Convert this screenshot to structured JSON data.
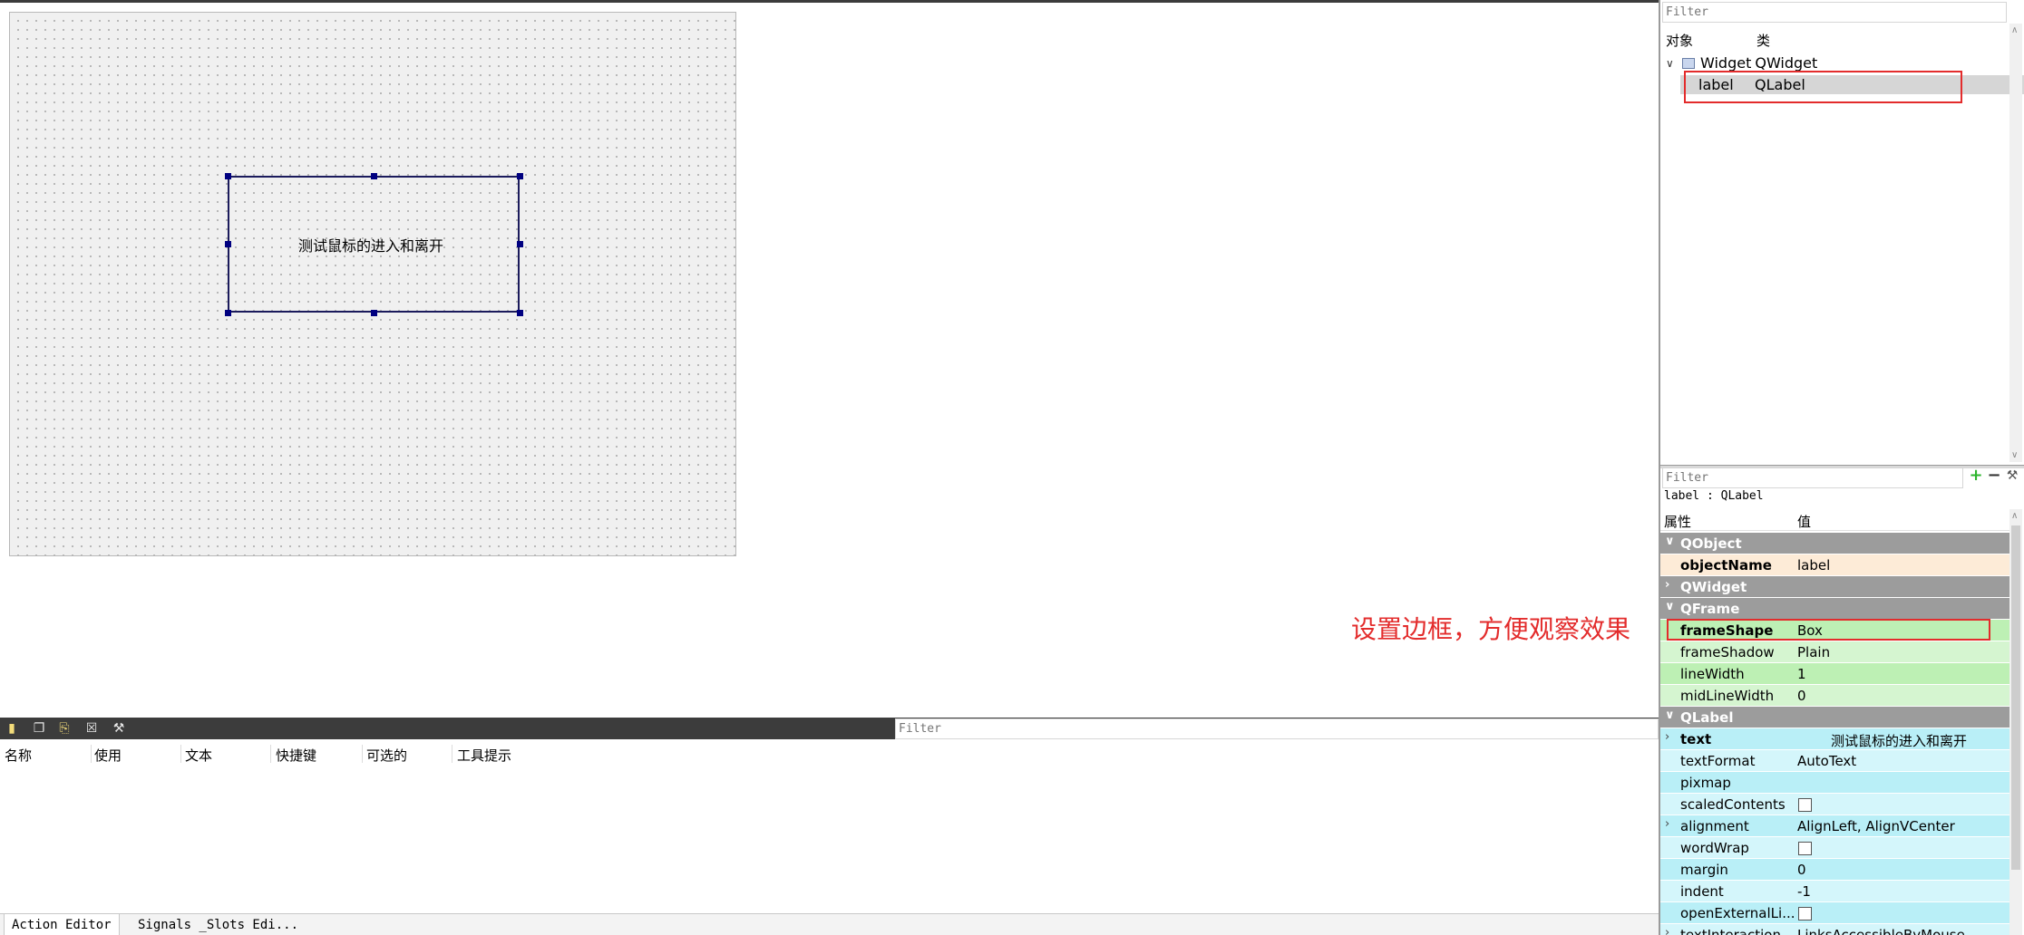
{
  "canvas": {
    "label_text": "测试鼠标的进入和离开"
  },
  "object_inspector": {
    "filter_placeholder": "Filter",
    "col_object": "对象",
    "col_class": "类",
    "tree": [
      {
        "name": "Widget",
        "class": "QWidget"
      },
      {
        "name": "label",
        "class": "QLabel"
      }
    ]
  },
  "property_editor": {
    "filter_placeholder": "Filter",
    "current_object": "label : QLabel",
    "col_property": "属性",
    "col_value": "值",
    "groups": {
      "qobject": "QObject",
      "qwidget": "QWidget",
      "qframe": "QFrame",
      "qlabel": "QLabel"
    },
    "rows": {
      "objectName": {
        "name": "objectName",
        "value": "label"
      },
      "frameShape": {
        "name": "frameShape",
        "value": "Box"
      },
      "frameShadow": {
        "name": "frameShadow",
        "value": "Plain"
      },
      "lineWidth": {
        "name": "lineWidth",
        "value": "1"
      },
      "midLineWidth": {
        "name": "midLineWidth",
        "value": "0"
      },
      "text": {
        "name": "text",
        "value": "测试鼠标的进入和离开"
      },
      "textFormat": {
        "name": "textFormat",
        "value": "AutoText"
      },
      "pixmap": {
        "name": "pixmap",
        "value": ""
      },
      "scaledContents": {
        "name": "scaledContents"
      },
      "alignment": {
        "name": "alignment",
        "value": "AlignLeft, AlignVCenter"
      },
      "wordWrap": {
        "name": "wordWrap"
      },
      "margin": {
        "name": "margin",
        "value": "0"
      },
      "indent": {
        "name": "indent",
        "value": "-1"
      },
      "openExternalLinks": {
        "name": "openExternalLi..."
      },
      "textInteraction": {
        "name": "textInteraction",
        "value": "LinksAccessibleByMouse"
      }
    }
  },
  "annotation": {
    "text": "设置边框，方便观察效果",
    "color": "#e32c2c"
  },
  "action_editor": {
    "filter_placeholder": "Filter",
    "columns": [
      "名称",
      "使用",
      "文本",
      "快捷键",
      "可选的",
      "工具提示"
    ],
    "tabs": [
      "Action Editor",
      "Signals _Slots Edi..."
    ]
  }
}
